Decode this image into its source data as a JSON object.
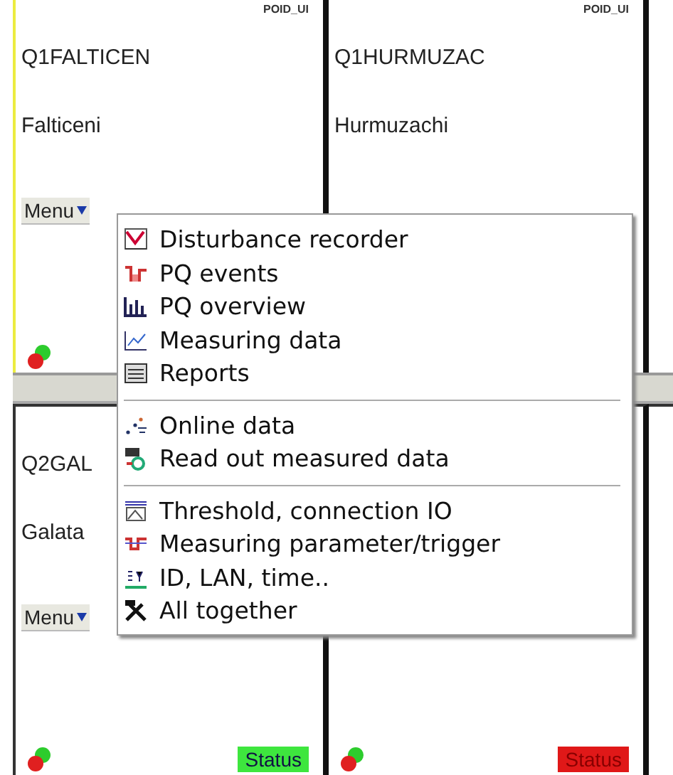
{
  "panels": [
    {
      "id_tag": "POID_UI",
      "code": "Q1FALTICEN",
      "name": "Falticeni",
      "menu_label": "Menu",
      "leds": true
    },
    {
      "id_tag": "POID_UI",
      "code": "Q1HURMUZAC",
      "name": "Hurmuzachi"
    },
    {
      "code": "Q2GAL",
      "name": "Galata",
      "menu_label": "Menu",
      "leds": true,
      "status": {
        "label": "Status",
        "alarm": false
      }
    },
    {
      "leds": true,
      "status": {
        "label": "Status",
        "alarm": true
      }
    }
  ],
  "menu": {
    "groups": [
      {
        "items": [
          "Disturbance recorder",
          "PQ events",
          "PQ overview",
          "Measuring data",
          "Reports"
        ]
      },
      {
        "items": [
          "Online data",
          "Read out measured data"
        ]
      },
      {
        "items": [
          "Threshold, connection IO",
          "Measuring parameter/trigger",
          "ID, LAN, time..",
          "All together"
        ]
      }
    ]
  }
}
